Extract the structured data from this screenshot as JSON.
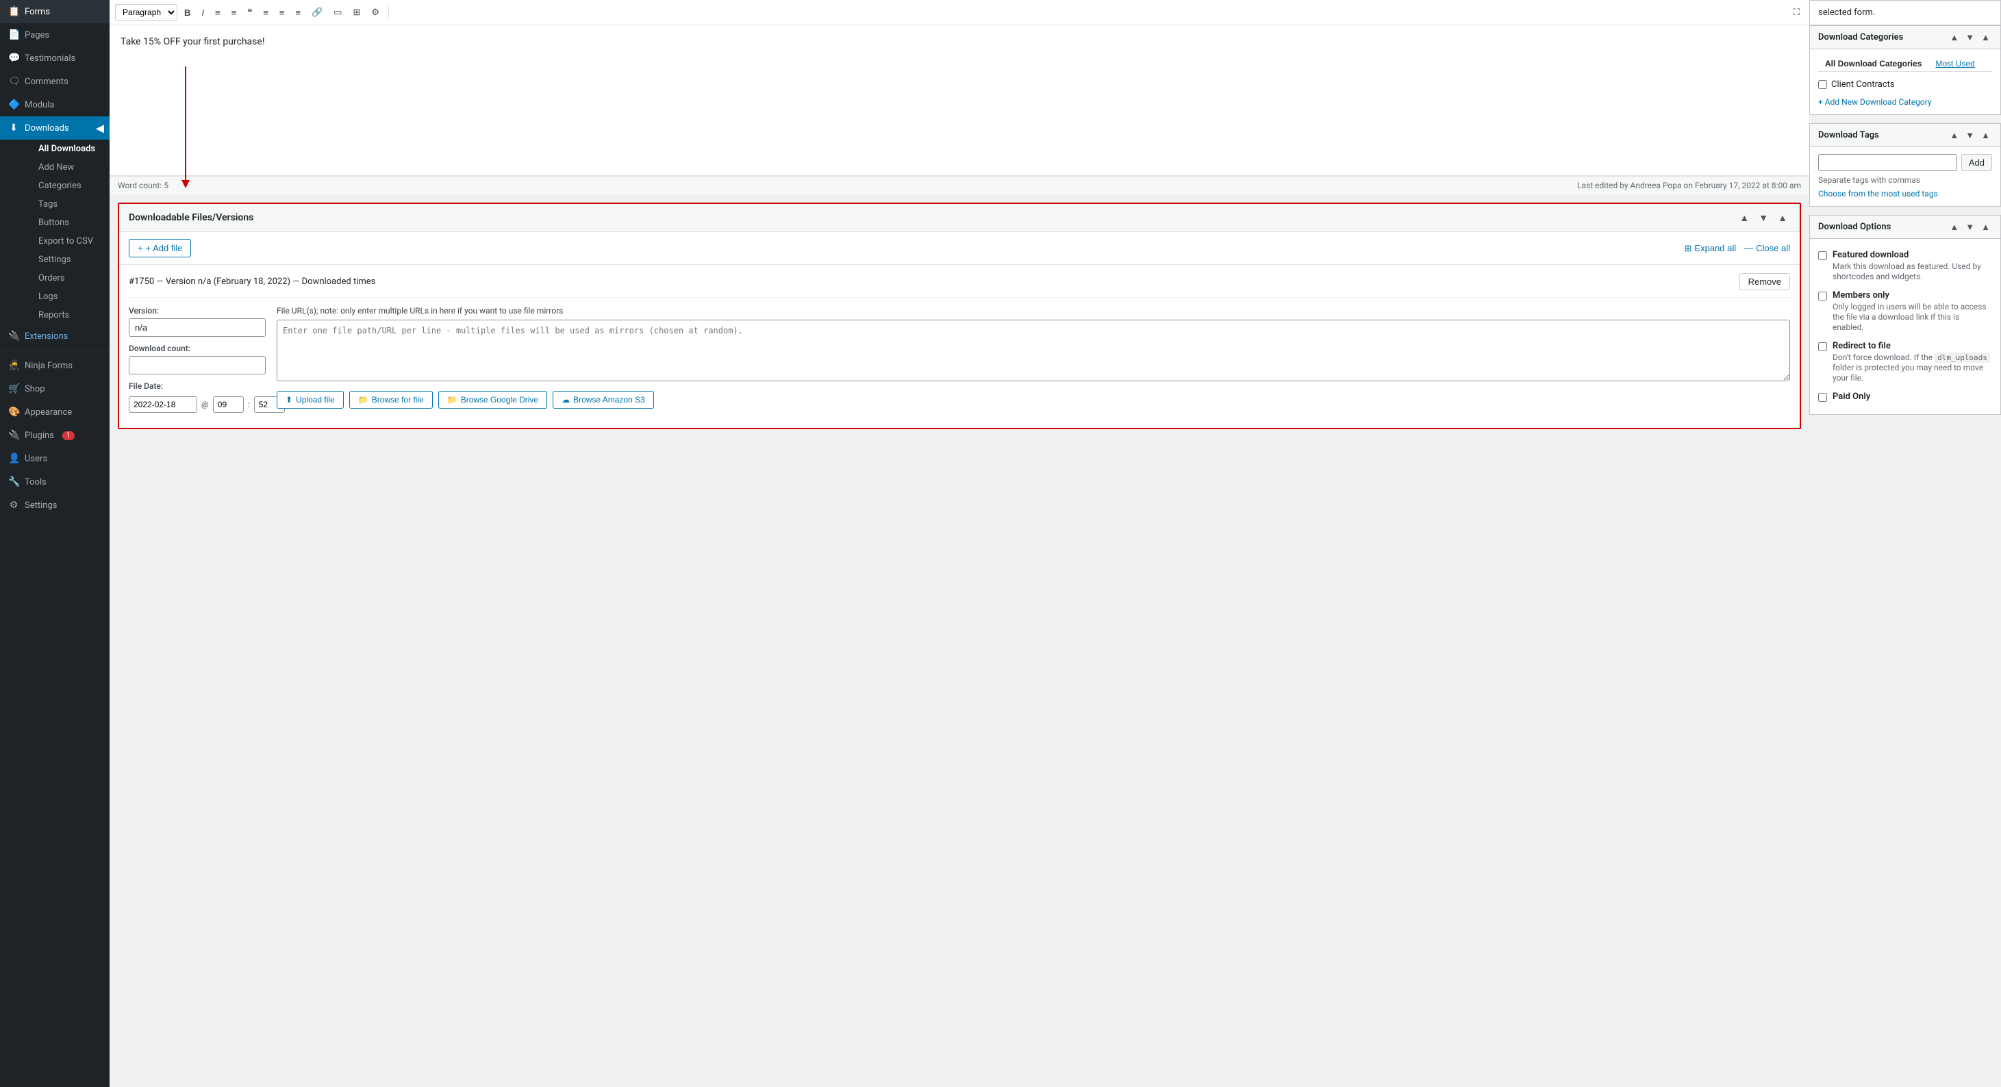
{
  "sidebar": {
    "items": [
      {
        "id": "forms",
        "label": "Forms",
        "icon": "📋"
      },
      {
        "id": "pages",
        "label": "Pages",
        "icon": "📄"
      },
      {
        "id": "testimonials",
        "label": "Testimonials",
        "icon": "💬"
      },
      {
        "id": "comments",
        "label": "Comments",
        "icon": "🗨"
      },
      {
        "id": "modula",
        "label": "Modula",
        "icon": "🔷"
      },
      {
        "id": "downloads",
        "label": "Downloads",
        "icon": "⬇",
        "active": true
      },
      {
        "id": "extensions",
        "label": "Extensions",
        "icon": "🔌",
        "highlight": true
      }
    ],
    "sub_items": [
      {
        "id": "all-downloads",
        "label": "All Downloads",
        "active": true
      },
      {
        "id": "add-new",
        "label": "Add New"
      },
      {
        "id": "categories",
        "label": "Categories"
      },
      {
        "id": "tags",
        "label": "Tags"
      },
      {
        "id": "buttons",
        "label": "Buttons"
      },
      {
        "id": "export-csv",
        "label": "Export to CSV"
      },
      {
        "id": "settings",
        "label": "Settings"
      },
      {
        "id": "orders",
        "label": "Orders"
      },
      {
        "id": "logs",
        "label": "Logs"
      },
      {
        "id": "reports",
        "label": "Reports"
      }
    ],
    "extra_items": [
      {
        "id": "ninja-forms",
        "label": "Ninja Forms",
        "icon": "🥷"
      },
      {
        "id": "shop",
        "label": "Shop",
        "icon": "🛒"
      },
      {
        "id": "appearance",
        "label": "Appearance",
        "icon": "🎨"
      },
      {
        "id": "plugins",
        "label": "Plugins",
        "icon": "🔌",
        "badge": "1"
      },
      {
        "id": "users",
        "label": "Users",
        "icon": "👤"
      },
      {
        "id": "tools",
        "label": "Tools",
        "icon": "🔧"
      },
      {
        "id": "settings-main",
        "label": "Settings",
        "icon": "⚙"
      }
    ]
  },
  "toolbar": {
    "paragraph_select": "Paragraph",
    "buttons": [
      "B",
      "I",
      "≡",
      "≡",
      "❝",
      "≡",
      "≡",
      "≡",
      "🔗",
      "▭",
      "⊞",
      "⚙"
    ]
  },
  "editor": {
    "content_text": "Take 15% OFF your first purchase!",
    "word_count_label": "Word count:",
    "word_count": "5",
    "last_edited": "Last edited by Andreea Popa on February 17, 2022 at 8:00 am"
  },
  "dlm": {
    "section_title": "Downloadable Files/Versions",
    "add_file_label": "+ Add file",
    "expand_all_label": "Expand all",
    "close_all_label": "Close all",
    "file_entry": {
      "title": "#1750 — Version n/a (February 18, 2022) — Downloaded times",
      "remove_label": "Remove",
      "version_label": "Version:",
      "version_value": "n/a",
      "download_count_label": "Download count:",
      "download_count_value": "",
      "file_date_label": "File Date:",
      "file_date_value": "2022-02-18",
      "file_date_at": "@",
      "file_date_hour": "09",
      "file_date_min": "52",
      "file_url_label": "File URL(s); note: only enter multiple URLs in here if you want to use file mirrors",
      "file_url_placeholder": "Enter one file path/URL per line - multiple files will be used as mirrors (chosen at random).",
      "upload_file_label": "Upload file",
      "browse_for_file_label": "Browse for file",
      "browse_gdrive_label": "Browse Google Drive",
      "browse_s3_label": "Browse Amazon S3"
    }
  },
  "right_sidebar": {
    "top_notice": "selected form.",
    "download_categories": {
      "title": "Download Categories",
      "tab_all": "All Download Categories",
      "tab_most_used": "Most Used",
      "categories": [
        {
          "label": "Client Contracts",
          "checked": false
        }
      ],
      "add_new_label": "+ Add New Download Category"
    },
    "download_tags": {
      "title": "Download Tags",
      "input_placeholder": "",
      "add_label": "Add",
      "hint": "Separate tags with commas",
      "choose_link": "Choose from the most used tags"
    },
    "download_options": {
      "title": "Download Options",
      "options": [
        {
          "id": "featured",
          "label": "Featured download",
          "desc": "Mark this download as featured. Used by shortcodes and widgets.",
          "checked": false
        },
        {
          "id": "members-only",
          "label": "Members only",
          "desc": "Only logged in users will be able to access the file via a download link if this is enabled.",
          "checked": false
        },
        {
          "id": "redirect",
          "label": "Redirect to file",
          "desc": "Don't force download. If the dlm_uploads folder is protected you may need to move your file.",
          "checked": false
        },
        {
          "id": "paid-only",
          "label": "Paid Only",
          "desc": "",
          "checked": false
        }
      ]
    }
  }
}
